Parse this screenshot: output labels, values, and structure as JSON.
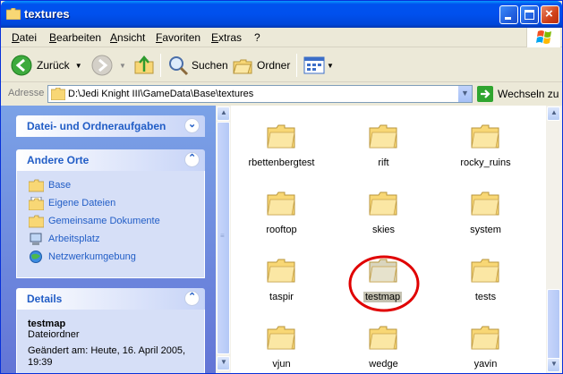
{
  "window": {
    "title": "textures",
    "controls": {
      "minimize": "minimize",
      "maximize": "maximize",
      "close": "close"
    }
  },
  "menu": [
    "Datei",
    "Bearbeiten",
    "Ansicht",
    "Favoriten",
    "Extras",
    "?"
  ],
  "toolbar": {
    "back_label": "Zurück",
    "search_label": "Suchen",
    "folders_label": "Ordner"
  },
  "address": {
    "label": "Adresse",
    "path": "D:\\Jedi Knight III\\GameData\\Base\\textures",
    "go_label": "Wechseln zu"
  },
  "sidebar": {
    "tasks_panel": {
      "title": "Datei- und Ordneraufgaben"
    },
    "places_panel": {
      "title": "Andere Orte",
      "items": [
        {
          "label": "Base",
          "icon": "folder-icon"
        },
        {
          "label": "Eigene Dateien",
          "icon": "documents-icon"
        },
        {
          "label": "Gemeinsame Dokumente",
          "icon": "folder-icon"
        },
        {
          "label": "Arbeitsplatz",
          "icon": "computer-icon"
        },
        {
          "label": "Netzwerkumgebung",
          "icon": "network-icon"
        }
      ]
    },
    "details_panel": {
      "title": "Details",
      "name": "testmap",
      "type": "Dateiordner",
      "modified": "Geändert am: Heute, 16. April 2005, 19:39"
    }
  },
  "files": [
    {
      "name": "rbettenbergtest",
      "selected": false
    },
    {
      "name": "rift",
      "selected": false
    },
    {
      "name": "rocky_ruins",
      "selected": false
    },
    {
      "name": "rooftop",
      "selected": false
    },
    {
      "name": "skies",
      "selected": false
    },
    {
      "name": "system",
      "selected": false
    },
    {
      "name": "taspir",
      "selected": false
    },
    {
      "name": "testmap",
      "selected": true
    },
    {
      "name": "tests",
      "selected": false
    },
    {
      "name": "vjun",
      "selected": false
    },
    {
      "name": "wedge",
      "selected": false
    },
    {
      "name": "yavin",
      "selected": false
    }
  ],
  "colors": {
    "titlebar": "#0053EE",
    "task_pane": "#7BA2E7",
    "panel_title": "#215DC6",
    "folder": "#F8D775",
    "annotation_circle": "#E00000"
  }
}
